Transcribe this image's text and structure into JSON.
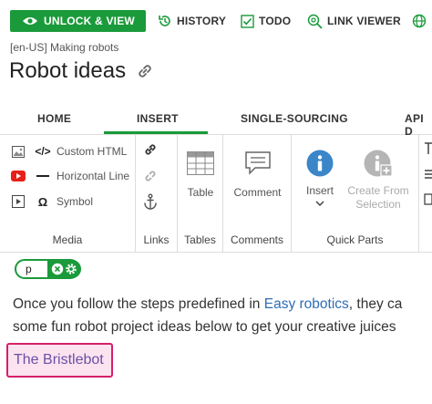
{
  "toolbar": {
    "unlock_label": "UNLOCK & VIEW",
    "history_label": "HISTORY",
    "todo_label": "TODO",
    "link_viewer_label": "LINK VIEWER",
    "accent": "#1a9a3a"
  },
  "breadcrumb": "[en-US] Making robots",
  "page_title": "Robot ideas",
  "tabs": [
    {
      "label": "HOME",
      "active": false
    },
    {
      "label": "INSERT",
      "active": true
    },
    {
      "label": "SINGLE-SOURCING",
      "active": false
    },
    {
      "label": "API D",
      "active": false
    }
  ],
  "ribbon": {
    "media": {
      "label": "Media",
      "items": [
        {
          "icon": "image-icon",
          "icon2": "code-icon",
          "label": "Custom HTML"
        },
        {
          "icon": "youtube-icon",
          "icon2": "horizontal-line-icon",
          "label": "Horizontal Line"
        },
        {
          "icon": "video-icon",
          "icon2": "omega-icon",
          "label": "Symbol"
        }
      ]
    },
    "links": {
      "label": "Links"
    },
    "tables": {
      "label": "Tables",
      "button": "Table"
    },
    "comments": {
      "label": "Comments",
      "button": "Comment"
    },
    "quick_parts": {
      "label": "Quick Parts",
      "insert": "Insert",
      "create_from": "Create From",
      "selection": "Selection"
    }
  },
  "element_tag": {
    "name": "p"
  },
  "content": {
    "para_line1_pre": "Once you follow the steps predefined in ",
    "para_link": "Easy robotics",
    "para_line1_post": ", they ca",
    "para_line2": "some fun robot project ideas below to get your creative juices",
    "heading": "The Bristlebot"
  }
}
